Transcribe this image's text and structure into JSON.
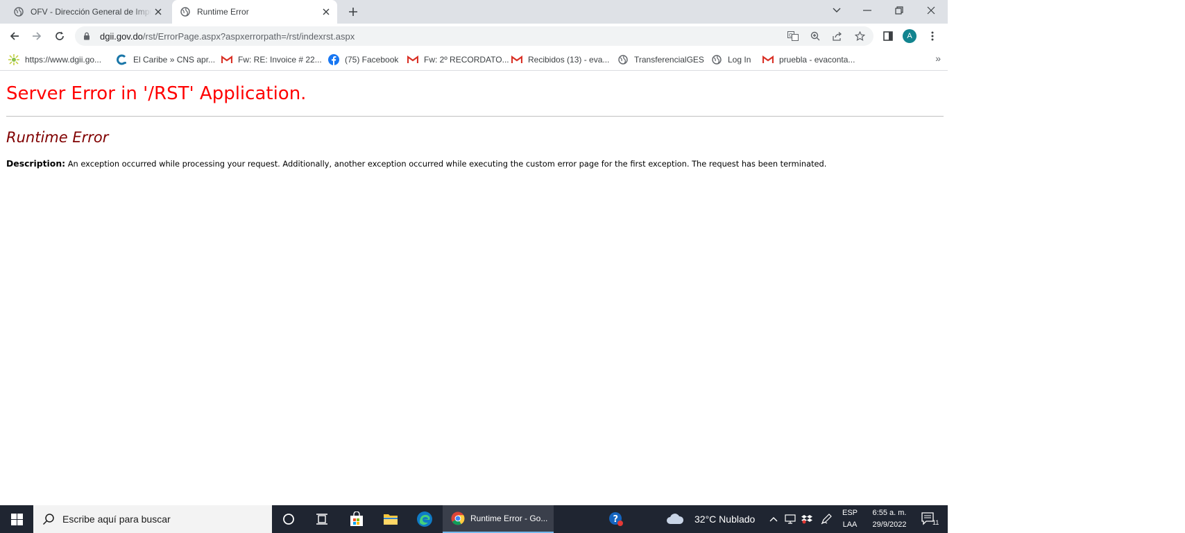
{
  "browser": {
    "tabs": [
      {
        "title": "OFV - Dirección General de Impuestos Internos",
        "active": false
      },
      {
        "title": "Runtime Error",
        "active": true
      }
    ],
    "address": {
      "host": "dgii.gov.do",
      "path": "/rst/ErrorPage.aspx?aspxerrorpath=/rst/indexrst.aspx"
    },
    "profile_initial": "A"
  },
  "bookmarks": [
    {
      "label": "https://www.dgii.go...",
      "icon": "dgii-icon"
    },
    {
      "label": "El Caribe » CNS apr...",
      "icon": "elcaribe-icon"
    },
    {
      "label": "Fw: RE: Invoice # 22...",
      "icon": "gmail-icon"
    },
    {
      "label": "(75) Facebook",
      "icon": "facebook-icon"
    },
    {
      "label": "Fw: 2º RECORDATO...",
      "icon": "gmail-icon"
    },
    {
      "label": "Recibidos (13) - eva...",
      "icon": "gmail-icon"
    },
    {
      "label": "TransferencialGES",
      "icon": "globe-icon"
    },
    {
      "label": "Log In",
      "icon": "globe-icon"
    },
    {
      "label": "pruebla - evaconta...",
      "icon": "gmail-icon"
    }
  ],
  "page": {
    "heading": "Server Error in '/RST' Application.",
    "subheading": "Runtime Error",
    "description_label": "Description:",
    "description_text": "An exception occurred while processing your request. Additionally, another exception occurred while executing the custom error page for the first exception. The request has been terminated."
  },
  "taskbar": {
    "search_placeholder": "Escribe aquí para buscar",
    "active_task_label": "Runtime Error - Go...",
    "weather": "32°C  Nublado",
    "language_top": "ESP",
    "language_bottom": "LAA",
    "time": "6:55 a. m.",
    "date": "29/9/2022",
    "notification_count": "11"
  },
  "colors": {
    "error_heading": "#ff0000",
    "error_subheading": "#800000",
    "taskbar": "#1f2531",
    "tabstrip": "#dee1e6"
  }
}
